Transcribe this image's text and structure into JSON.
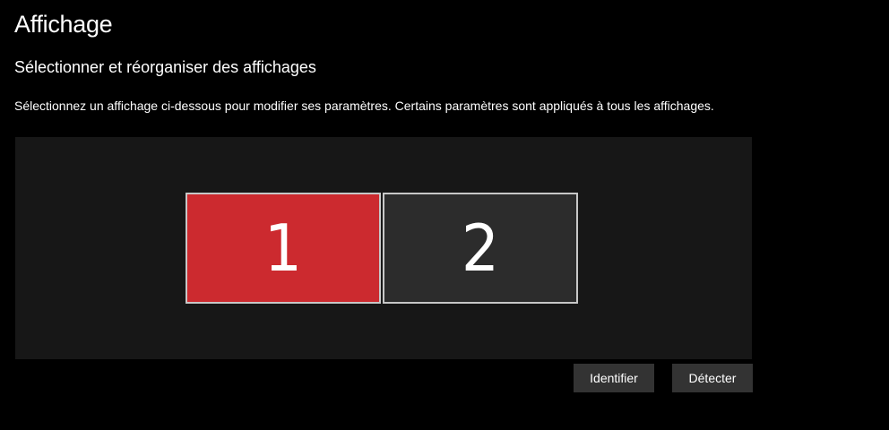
{
  "page": {
    "title": "Affichage"
  },
  "section": {
    "title": "Sélectionner et réorganiser des affichages",
    "description": "Sélectionnez un affichage ci-dessous pour modifier ses paramètres. Certains paramètres sont appliqués à tous les affichages."
  },
  "displays": [
    {
      "number": "1",
      "selected": true,
      "color": "#cc2a2f"
    },
    {
      "number": "2",
      "selected": false,
      "color": "#2c2c2c"
    }
  ],
  "buttons": {
    "identify_label": "Identifier",
    "detect_label": "Détecter"
  },
  "colors": {
    "background": "#000000",
    "arrangement_panel": "#171717",
    "accent_selected": "#cc2a2f",
    "button_bg": "#333333"
  }
}
